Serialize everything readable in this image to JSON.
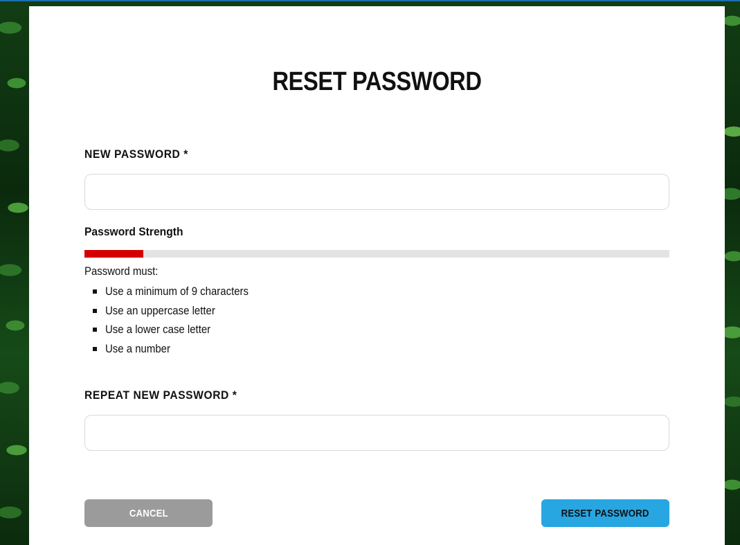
{
  "page": {
    "title": "RESET PASSWORD"
  },
  "form": {
    "new_password": {
      "label": "NEW PASSWORD *",
      "value": "",
      "placeholder": ""
    },
    "strength": {
      "label": "Password Strength",
      "level_fraction": 0.1,
      "fill_color": "#d40000",
      "track_color": "#e3e3e3"
    },
    "rules": {
      "intro": "Password must:",
      "items": [
        "Use a minimum of 9 characters",
        "Use an uppercase letter",
        "Use a lower case letter",
        "Use a number"
      ]
    },
    "repeat_password": {
      "label": "REPEAT NEW PASSWORD *",
      "value": "",
      "placeholder": ""
    }
  },
  "actions": {
    "cancel_label": "CANCEL",
    "cancel_color": "#9b9b9b",
    "reset_label": "RESET PASSWORD",
    "reset_color": "#27a6e2"
  }
}
